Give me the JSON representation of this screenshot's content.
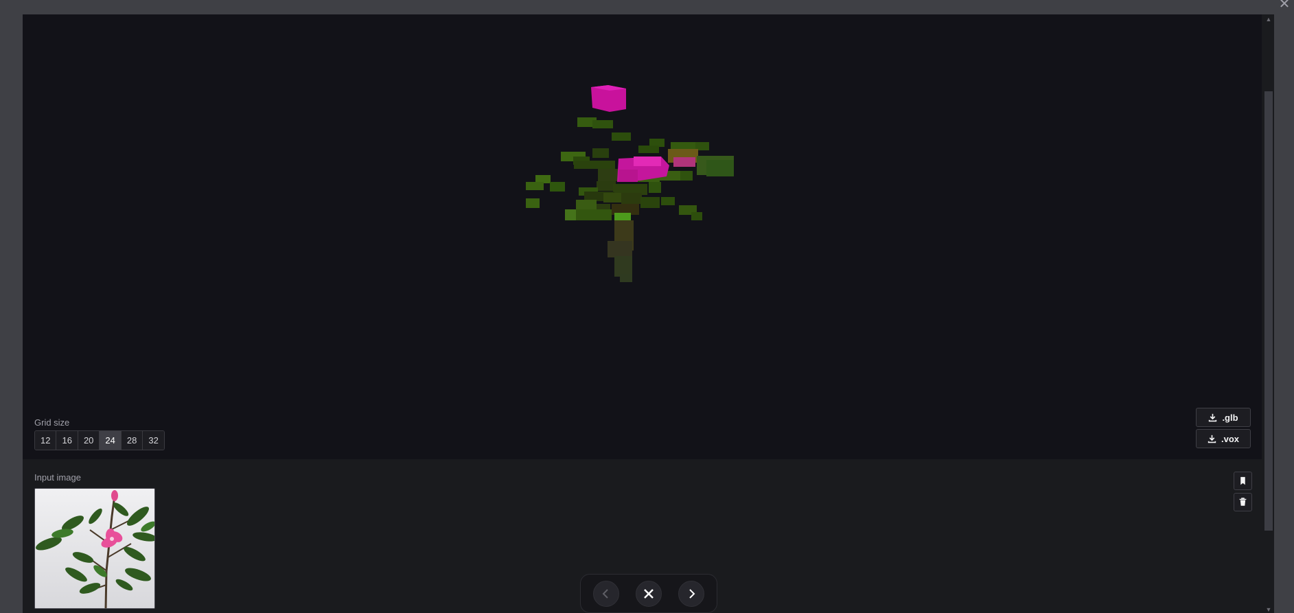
{
  "overlay": {
    "close_icon": "close-icon"
  },
  "viewer": {
    "grid_size_label": "Grid size",
    "grid_sizes": [
      "12",
      "16",
      "20",
      "24",
      "28",
      "32"
    ],
    "selected_grid_size": "24",
    "download_glb_label": ".glb",
    "download_vox_label": ".vox"
  },
  "input": {
    "label": "Input image",
    "bookmark_icon": "bookmark-icon",
    "delete_icon": "trash-icon"
  },
  "nav": {
    "prev_icon": "chevron-left-icon",
    "close_icon": "close-icon",
    "next_icon": "chevron-right-icon"
  },
  "colors": {
    "viewer_bg": "#121218",
    "panel_bg": "#1a1b1e",
    "flower_magenta": "#d61aa8",
    "leaf_green": "#3f6b12",
    "stem_olive": "#4a4a22"
  }
}
